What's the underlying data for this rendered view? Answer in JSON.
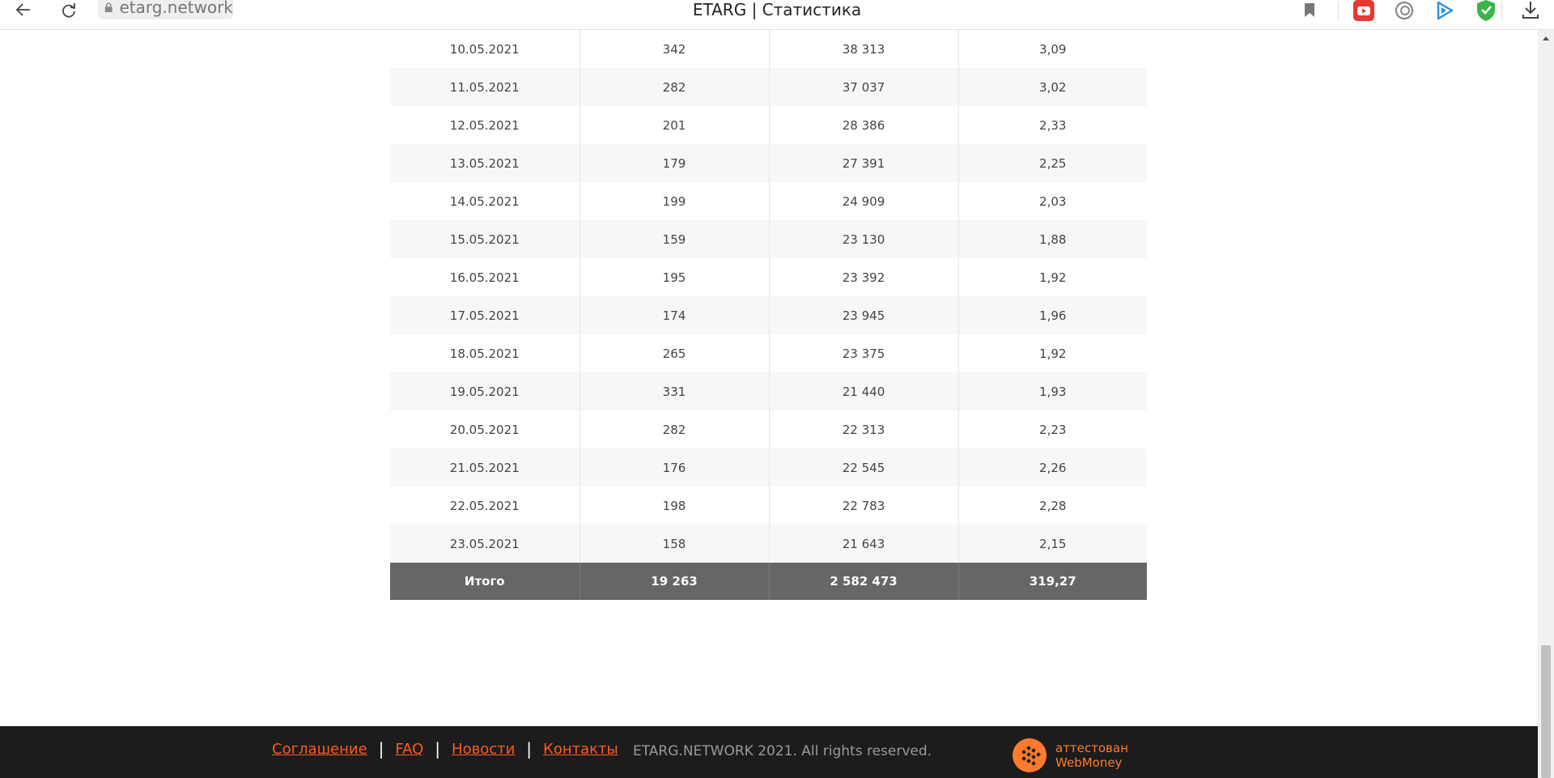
{
  "browser": {
    "url": "etarg.network",
    "title": "ETARG | Статистика"
  },
  "table": {
    "rows": [
      [
        "10.05.2021",
        "342",
        "38 313",
        "3,09"
      ],
      [
        "11.05.2021",
        "282",
        "37 037",
        "3,02"
      ],
      [
        "12.05.2021",
        "201",
        "28 386",
        "2,33"
      ],
      [
        "13.05.2021",
        "179",
        "27 391",
        "2,25"
      ],
      [
        "14.05.2021",
        "199",
        "24 909",
        "2,03"
      ],
      [
        "15.05.2021",
        "159",
        "23 130",
        "1,88"
      ],
      [
        "16.05.2021",
        "195",
        "23 392",
        "1,92"
      ],
      [
        "17.05.2021",
        "174",
        "23 945",
        "1,96"
      ],
      [
        "18.05.2021",
        "265",
        "23 375",
        "1,92"
      ],
      [
        "19.05.2021",
        "331",
        "21 440",
        "1,93"
      ],
      [
        "20.05.2021",
        "282",
        "22 313",
        "2,23"
      ],
      [
        "21.05.2021",
        "176",
        "22 545",
        "2,26"
      ],
      [
        "22.05.2021",
        "198",
        "22 783",
        "2,28"
      ],
      [
        "23.05.2021",
        "158",
        "21 643",
        "2,15"
      ]
    ],
    "total": [
      "Итого",
      "19 263",
      "2 582 473",
      "319,27"
    ]
  },
  "footer": {
    "links": [
      {
        "label": "Соглашение"
      },
      {
        "label": "FAQ"
      },
      {
        "label": "Новости"
      },
      {
        "label": "Контакты"
      }
    ],
    "separator": "|",
    "copyright": "ETARG.NETWORK 2021. All rights reserved.",
    "badge_line1": "аттестован",
    "badge_line2": "WebMoney"
  },
  "colors": {
    "accent": "#ff5a1e",
    "total_row_bg": "#666666",
    "footer_bg": "#1c1c1c"
  }
}
